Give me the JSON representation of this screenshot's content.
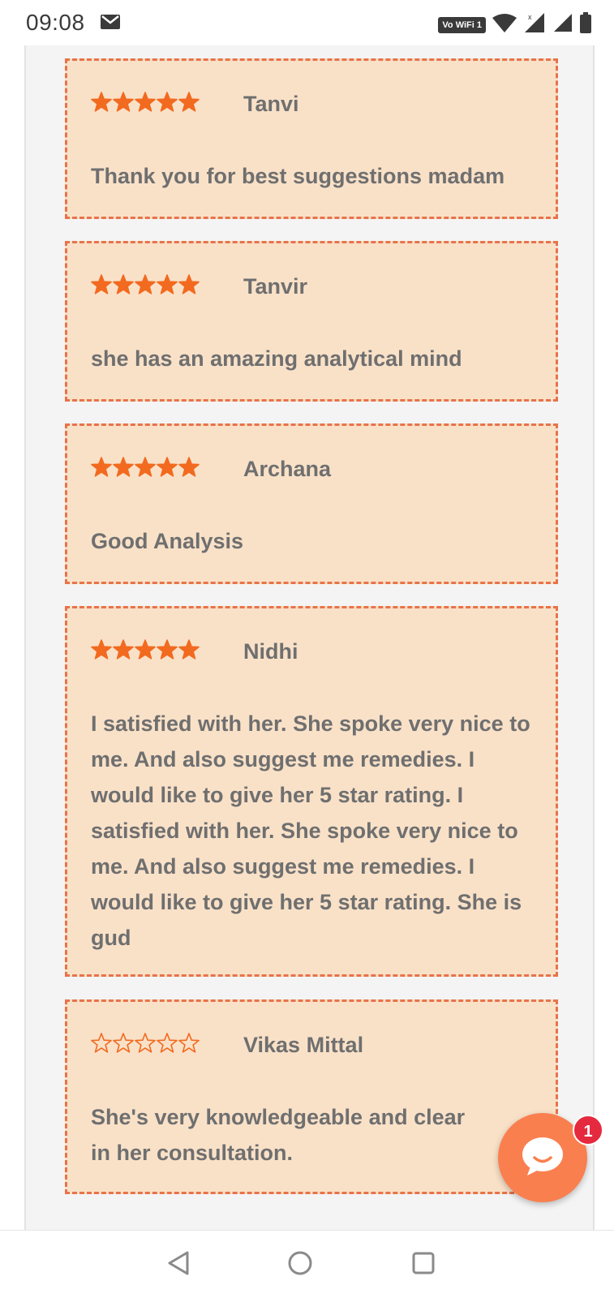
{
  "status_bar": {
    "time": "09:08",
    "network_label": "Vo WiFi 1",
    "icons": [
      "mail-icon",
      "wifi-icon",
      "signal-icon",
      "signal-icon",
      "battery-icon"
    ]
  },
  "colors": {
    "card_background": "#f9e1c8",
    "card_border": "#e8734a",
    "star_color": "#f26a1f",
    "text_color": "#6f6f6f",
    "chat_button": "#fa7f4f",
    "badge": "#e5293f"
  },
  "reviews": [
    {
      "name": "Tanvi",
      "rating": 5,
      "text": "Thank you for best suggestions madam"
    },
    {
      "name": "Tanvir",
      "rating": 5,
      "text": "she has an amazing analytical mind"
    },
    {
      "name": "Archana",
      "rating": 5,
      "text": "Good Analysis"
    },
    {
      "name": "Nidhi",
      "rating": 5,
      "text": "I satisfied with her. She spoke very nice to me. And also suggest me remedies. I would like to give her 5 star rating. I satisfied with her. She spoke very nice to me. And also suggest me remedies. I would like to give her 5 star rating. She is gud"
    },
    {
      "name": "Vikas Mittal",
      "rating": 0,
      "text": "She's very knowledgeable and clear in her consultation."
    }
  ],
  "chat": {
    "badge_count": "1",
    "icon": "chat-bubble-icon"
  },
  "nav_bar": {
    "buttons": [
      "back-icon",
      "home-icon",
      "recents-icon"
    ]
  }
}
